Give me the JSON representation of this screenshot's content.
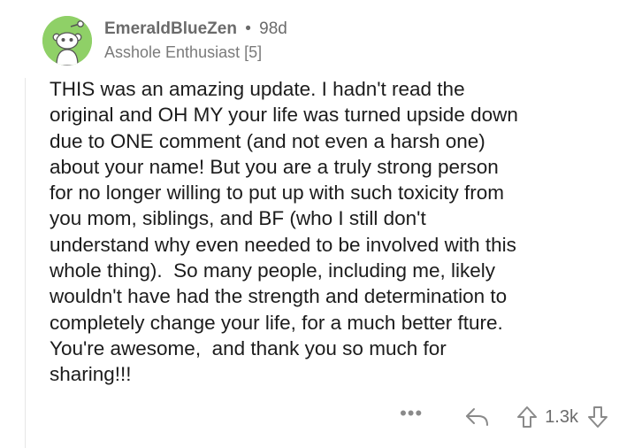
{
  "comment": {
    "username": "EmeraldBlueZen",
    "separator": "•",
    "age": "98d",
    "flair": "Asshole Enthusiast [5]",
    "avatar_icon": "snoo-avatar-icon",
    "avatar_bg": "#8fd067",
    "body": "THIS was an amazing update. I hadn't read the\noriginal and OH MY your life was turned upside down\ndue to ONE comment (and not even a harsh one)\nabout your name! But you are a truly strong person\nfor no longer willing to put up with such toxicity from\nyou mom, siblings, and BF (who I still don't\nunderstand why even needed to be involved with this\nwhole thing).  So many people, including me, likely\nwouldn't have had the strength and determination to\ncompletely change your life, for a much better fture.\nYou're awesome,  and thank you so much for\nsharing!!!"
  },
  "actions": {
    "more_label": "•••",
    "reply_icon": "reply-arrow-icon",
    "upvote_icon": "upvote-arrow-icon",
    "score": "1.3k",
    "downvote_icon": "downvote-arrow-icon"
  }
}
